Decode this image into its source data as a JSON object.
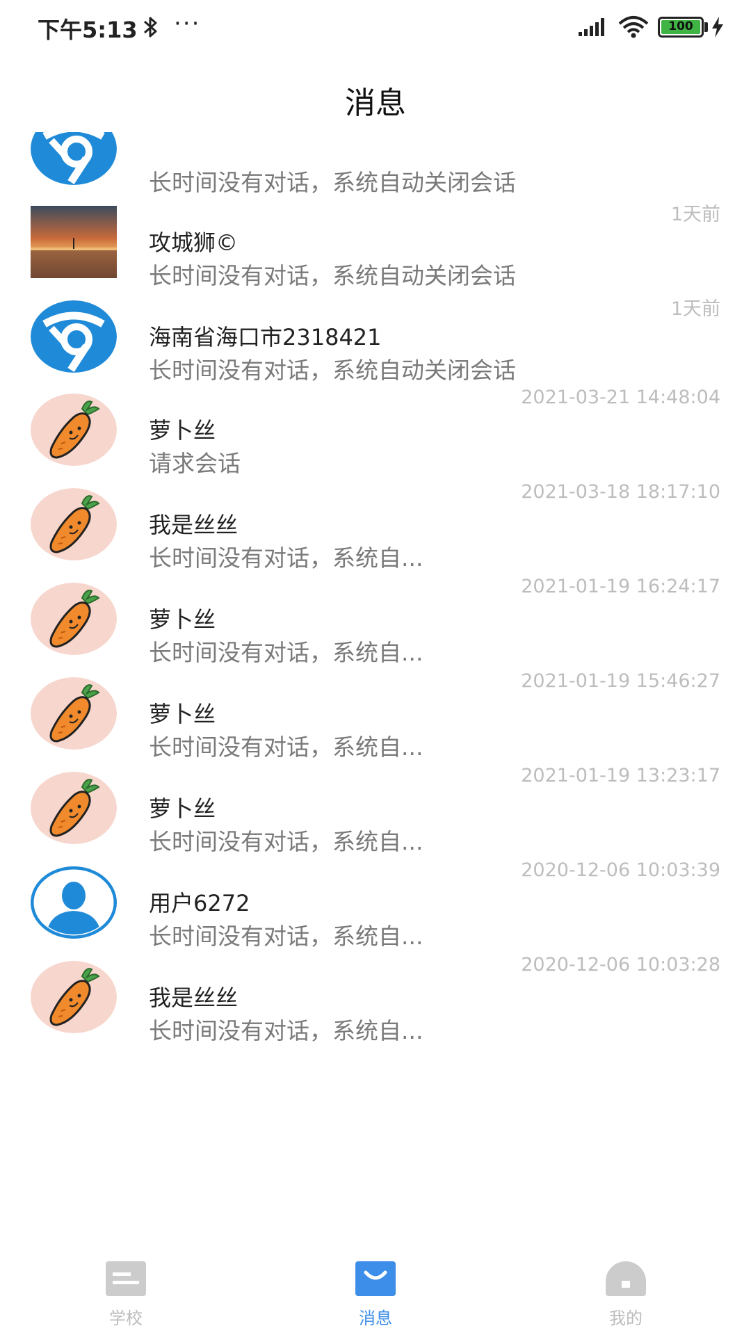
{
  "status_bar": {
    "time": "下午5:13",
    "dots": "···",
    "battery": "100"
  },
  "header": {
    "title": "消息"
  },
  "conversations": [
    {
      "avatar": "browser-logo-icon",
      "name": "",
      "preview": "长时间没有对话，系统自动关闭会话",
      "time": ""
    },
    {
      "avatar": "sunset-photo",
      "name": "攻城狮©",
      "preview": "长时间没有对话，系统自动关闭会话",
      "time": "1天前"
    },
    {
      "avatar": "browser-logo-icon",
      "name": "海南省海口市2318421",
      "preview": "长时间没有对话，系统自动关闭会话",
      "time": "1天前"
    },
    {
      "avatar": "carrot-icon",
      "name": "萝卜丝",
      "preview": "请求会话",
      "time": "2021-03-21 14:48:04"
    },
    {
      "avatar": "carrot-icon",
      "name": "我是丝丝",
      "preview": "长时间没有对话，系统自...",
      "time": "2021-03-18 18:17:10"
    },
    {
      "avatar": "carrot-icon",
      "name": "萝卜丝",
      "preview": "长时间没有对话，系统自...",
      "time": "2021-01-19 16:24:17"
    },
    {
      "avatar": "carrot-icon",
      "name": "萝卜丝",
      "preview": "长时间没有对话，系统自...",
      "time": "2021-01-19 15:46:27"
    },
    {
      "avatar": "carrot-icon",
      "name": "萝卜丝",
      "preview": "长时间没有对话，系统自...",
      "time": "2021-01-19 13:23:17"
    },
    {
      "avatar": "user-silhouette-icon",
      "name": "用户6272",
      "preview": "长时间没有对话，系统自...",
      "time": "2020-12-06 10:03:39"
    },
    {
      "avatar": "carrot-icon",
      "name": "我是丝丝",
      "preview": "长时间没有对话，系统自...",
      "time": "2020-12-06 10:03:28"
    }
  ],
  "tabbar": {
    "tabs": [
      {
        "label": "学校",
        "icon": "school-icon",
        "active": false
      },
      {
        "label": "消息",
        "icon": "message-icon",
        "active": true
      },
      {
        "label": "我的",
        "icon": "profile-icon",
        "active": false
      }
    ]
  },
  "colors": {
    "accent": "#3d8ee8",
    "inactive_tab": "#cccccc",
    "timestamp": "#bdbdbd",
    "preview_text": "#7a7a7a",
    "carrot_bg": "#f7d6cd",
    "browser_blue": "#1f8bd8"
  }
}
